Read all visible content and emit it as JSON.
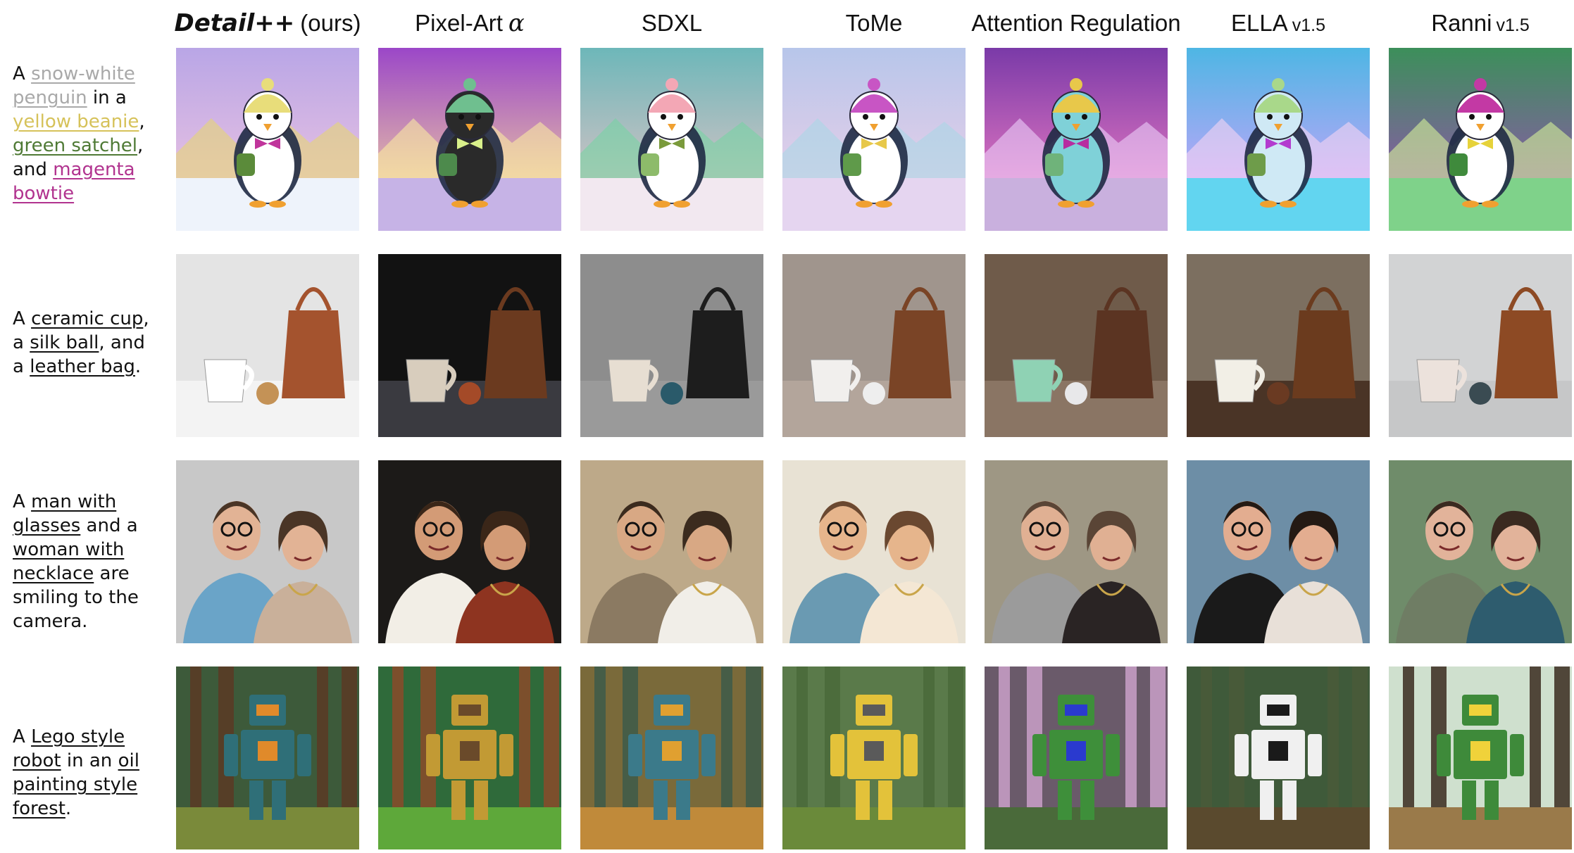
{
  "columns": [
    {
      "main": "Detail++",
      "suffix": "(ours)",
      "style": "bold-italic"
    },
    {
      "main": "Pixel-Art",
      "suffix": "α",
      "style": "greek"
    },
    {
      "main": "SDXL",
      "suffix": "",
      "style": "plain"
    },
    {
      "main": "ToMe",
      "suffix": "",
      "style": "plain"
    },
    {
      "main": "Attention Regulation",
      "suffix": "",
      "style": "plain"
    },
    {
      "main": "ELLA",
      "suffix": "v1.5",
      "style": "small"
    },
    {
      "main": "Ranni",
      "suffix": "v1.5",
      "style": "small"
    }
  ],
  "rows": [
    {
      "segments": [
        {
          "text": "A ",
          "u": false,
          "color": "#111111"
        },
        {
          "text": "snow-white penguin",
          "u": true,
          "color": "#a9a9a9"
        },
        {
          "text": " in a ",
          "u": false,
          "color": "#111111"
        },
        {
          "text": "yellow beanie",
          "u": true,
          "color": "#d6c25a"
        },
        {
          "text": ", ",
          "u": false,
          "color": "#111111"
        },
        {
          "text": "green satchel",
          "u": true,
          "color": "#4f7a35"
        },
        {
          "text": ", and ",
          "u": false,
          "color": "#111111"
        },
        {
          "text": "magenta bowtie",
          "u": true,
          "color": "#b1338f"
        }
      ],
      "scene": "penguin"
    },
    {
      "segments": [
        {
          "text": "A ",
          "u": false,
          "color": "#111111"
        },
        {
          "text": "ceramic cup",
          "u": true,
          "color": "#111111"
        },
        {
          "text": ", a ",
          "u": false,
          "color": "#111111"
        },
        {
          "text": "silk ball",
          "u": true,
          "color": "#111111"
        },
        {
          "text": ", and a ",
          "u": false,
          "color": "#111111"
        },
        {
          "text": "leather bag",
          "u": true,
          "color": "#111111"
        },
        {
          "text": ".",
          "u": false,
          "color": "#111111"
        }
      ],
      "scene": "still"
    },
    {
      "segments": [
        {
          "text": "A ",
          "u": false,
          "color": "#111111"
        },
        {
          "text": "man with glasses",
          "u": true,
          "color": "#111111"
        },
        {
          "text": " and a ",
          "u": false,
          "color": "#111111"
        },
        {
          "text": "woman with necklace",
          "u": true,
          "color": "#111111"
        },
        {
          "text": " are smiling to the camera.",
          "u": false,
          "color": "#111111"
        }
      ],
      "scene": "couple"
    },
    {
      "segments": [
        {
          "text": "A ",
          "u": false,
          "color": "#111111"
        },
        {
          "text": "Lego style robot",
          "u": true,
          "color": "#111111"
        },
        {
          "text": " in an ",
          "u": false,
          "color": "#111111"
        },
        {
          "text": "oil painting style forest",
          "u": true,
          "color": "#111111"
        },
        {
          "text": ".",
          "u": false,
          "color": "#111111"
        }
      ],
      "scene": "robot"
    }
  ],
  "palettes": {
    "penguin": [
      {
        "sky1": "#b9a6e6",
        "sky2": "#f6c9e0",
        "ground": "#eef3fb",
        "accent": "#e7d86a",
        "body": "#ffffff",
        "hat": "#e8dd7a",
        "bow": "#c0359b",
        "bag": "#5b8b3a"
      },
      {
        "sky1": "#9b47c8",
        "sky2": "#ffe79a",
        "ground": "#c6b3e6",
        "accent": "#fff2a0",
        "body": "#2a2a2a",
        "hat": "#6fbf8f",
        "bow": "#d9f08a",
        "bag": "#4d8a4c"
      },
      {
        "sky1": "#6db7b9",
        "sky2": "#f4c6c8",
        "ground": "#f2e8f0",
        "accent": "#72d6a0",
        "body": "#ffffff",
        "hat": "#f3a7b5",
        "bow": "#7a9a3b",
        "bag": "#8dbb6a"
      },
      {
        "sky1": "#b7c6ea",
        "sky2": "#f5d1e8",
        "ground": "#e5d5f0",
        "accent": "#a6d9e6",
        "body": "#ffffff",
        "hat": "#c855c4",
        "bow": "#e7c84a",
        "bag": "#5f9a4a"
      },
      {
        "sky1": "#7a3aa8",
        "sky2": "#ff88c8",
        "ground": "#c9b0de",
        "accent": "#f0d9ff",
        "body": "#7fd1d8",
        "hat": "#e8c84a",
        "bow": "#b72ca0",
        "bag": "#6fb37a"
      },
      {
        "sky1": "#4eb6e4",
        "sky2": "#e3a0ff",
        "ground": "#62d5f0",
        "accent": "#ffd9f2",
        "body": "#cfe9f5",
        "hat": "#a9d88a",
        "bow": "#b33bcf",
        "bag": "#6e9c4a"
      },
      {
        "sky1": "#3c8f5a",
        "sky2": "#a54ac2",
        "ground": "#7fd28a",
        "accent": "#e0ff9a",
        "body": "#ffffff",
        "hat": "#c339a4",
        "bow": "#e6d23a",
        "bag": "#3f8a3c"
      }
    ],
    "still": [
      {
        "wall": "#e4e4e4",
        "table": "#f3f3f3",
        "cup": "#ffffff",
        "ball": "#c49256",
        "bag": "#a4532e"
      },
      {
        "wall": "#121212",
        "table": "#3a3a40",
        "cup": "#d8cdbd",
        "ball": "#a44a28",
        "bag": "#6b3a1f"
      },
      {
        "wall": "#8d8d8d",
        "table": "#9a9a9a",
        "cup": "#e7ded2",
        "ball": "#2a5a6a",
        "bag": "#1d1d1d"
      },
      {
        "wall": "#a0958d",
        "table": "#b3a59b",
        "cup": "#f1efed",
        "ball": "#eeeeee",
        "bag": "#7a4426"
      },
      {
        "wall": "#6f5b4a",
        "table": "#8a7564",
        "cup": "#8fd2b4",
        "ball": "#e8e8ea",
        "bag": "#5b3422"
      },
      {
        "wall": "#7c6f60",
        "table": "#4a3426",
        "cup": "#f2efe6",
        "ball": "#6a3a22",
        "bag": "#6b3b1e"
      },
      {
        "wall": "#d2d3d4",
        "table": "#c6c7c8",
        "cup": "#ece2dc",
        "ball": "#3a4b52",
        "bag": "#8d4a24"
      }
    ],
    "couple": [
      {
        "bg": "#c8c8c8",
        "man": "#6aa4c8",
        "woman": "#c9b09a",
        "skin": "#e2b395",
        "hair": "#4a3526"
      },
      {
        "bg": "#1c1a18",
        "man": "#f2eee6",
        "woman": "#8e3420",
        "skin": "#d39b76",
        "hair": "#3a2618"
      },
      {
        "bg": "#bda989",
        "man": "#8b7a62",
        "woman": "#f1eee8",
        "skin": "#d8a884",
        "hair": "#3b2b1e"
      },
      {
        "bg": "#e8e2d4",
        "man": "#6a9ab2",
        "woman": "#f4e7d4",
        "skin": "#e6b58c",
        "hair": "#6a4830"
      },
      {
        "bg": "#9e9784",
        "man": "#9b9b9b",
        "woman": "#2a2424",
        "skin": "#e0b093",
        "hair": "#5a4536"
      },
      {
        "bg": "#6d8ea6",
        "man": "#1a1a1a",
        "woman": "#e8e0d8",
        "skin": "#e3ad90",
        "hair": "#241a14"
      },
      {
        "bg": "#6f8c6a",
        "man": "#6f7d64",
        "woman": "#2e5c6e",
        "skin": "#e2b39a",
        "hair": "#3a2a20"
      }
    ],
    "robot": [
      {
        "bg": "#3d5a3a",
        "trees": "#5a3a24",
        "floor": "#7a8a3a",
        "robot": "#2f6f78",
        "accent": "#e08a2a"
      },
      {
        "bg": "#2f6a3a",
        "trees": "#8a4a2a",
        "floor": "#5ea83a",
        "robot": "#c29a34",
        "accent": "#6a4a2a"
      },
      {
        "bg": "#7a6a3a",
        "trees": "#3d5a4a",
        "floor": "#c08a3a",
        "robot": "#3b7a8a",
        "accent": "#e0a030"
      },
      {
        "bg": "#5a7a4a",
        "trees": "#4a6a3a",
        "floor": "#6a8a3a",
        "robot": "#e3c23a",
        "accent": "#5a5a5a"
      },
      {
        "bg": "#6a5a6a",
        "trees": "#c9a0c8",
        "floor": "#4a6a3a",
        "robot": "#3e8f3a",
        "accent": "#2a3acf"
      },
      {
        "bg": "#3f5a3a",
        "trees": "#4a5a3a",
        "floor": "#5a4a2e",
        "robot": "#f0f0f0",
        "accent": "#1a1a1a"
      },
      {
        "bg": "#cfe0ce",
        "trees": "#3a2a1e",
        "floor": "#9a7a4a",
        "robot": "#3e8a3a",
        "accent": "#f0d23a"
      }
    ]
  }
}
